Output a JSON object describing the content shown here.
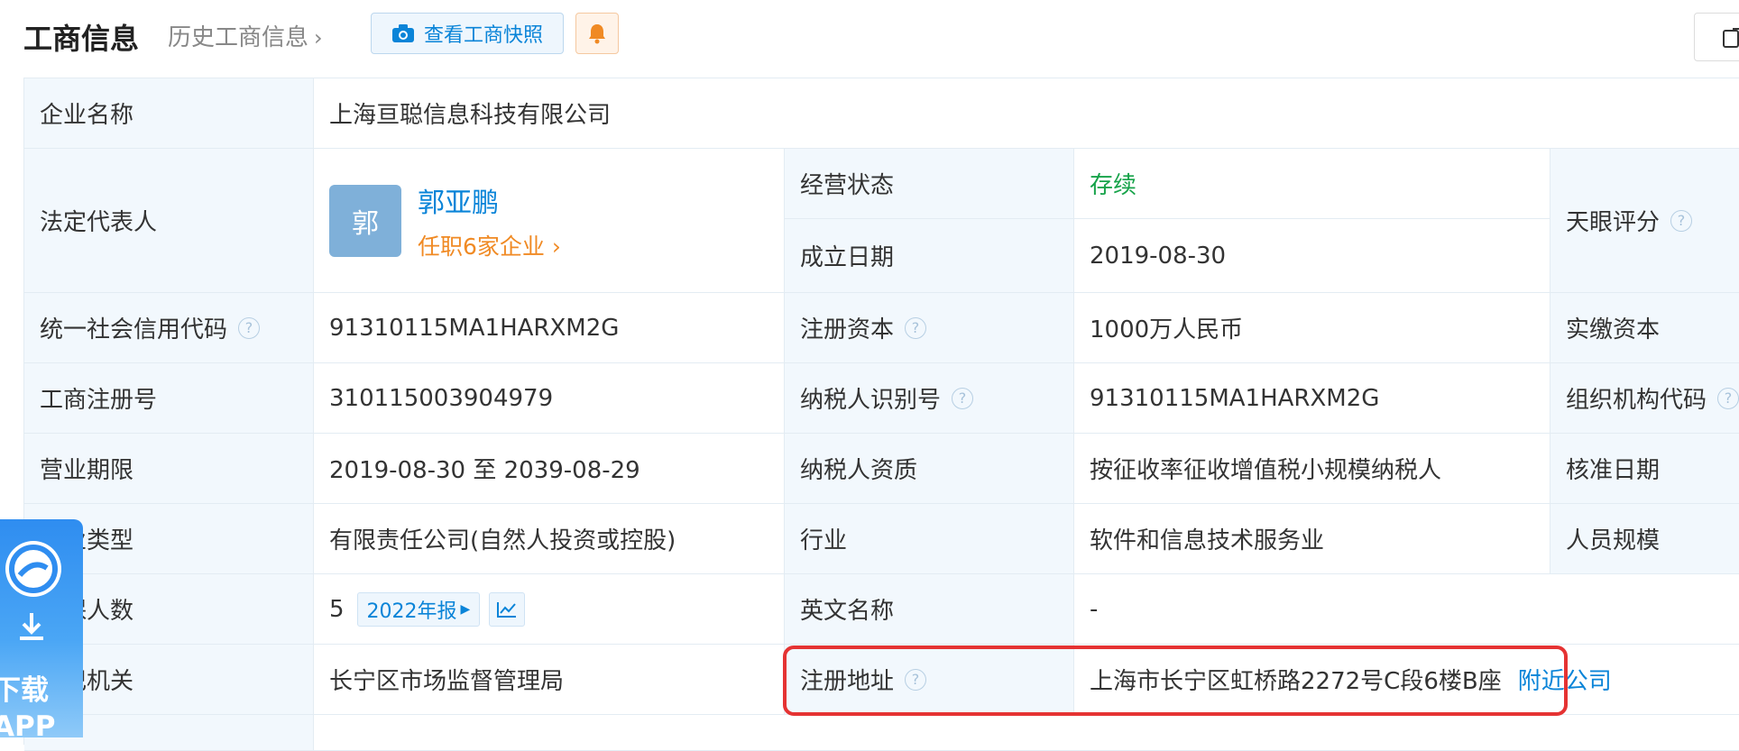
{
  "header": {
    "title": "工商信息",
    "history_link": "历史工商信息",
    "snapshot_button": "查看工商快照"
  },
  "rows": {
    "company_name": {
      "label": "企业名称",
      "value": "上海亘聪信息科技有限公司"
    },
    "legal_rep": {
      "label": "法定代表人",
      "avatar_char": "郭",
      "name": "郭亚鹏",
      "positions": "任职6家企业"
    },
    "status": {
      "label": "经营状态",
      "value": "存续"
    },
    "found_date": {
      "label": "成立日期",
      "value": "2019-08-30"
    },
    "tianyan_score": {
      "label": "天眼评分"
    },
    "credit_code": {
      "label": "统一社会信用代码",
      "value": "91310115MA1HARXM2G"
    },
    "reg_capital": {
      "label": "注册资本",
      "value": "1000万人民币"
    },
    "paid_capital": {
      "label": "实缴资本"
    },
    "reg_number": {
      "label": "工商注册号",
      "value": "310115003904979"
    },
    "taxpayer_id": {
      "label": "纳税人识别号",
      "value": "91310115MA1HARXM2G"
    },
    "org_code": {
      "label": "组织机构代码"
    },
    "business_term": {
      "label": "营业期限",
      "value": "2019-08-30 至 2039-08-29"
    },
    "taxpayer_qual": {
      "label": "纳税人资质",
      "value": "按征收率征收增值税小规模纳税人"
    },
    "approval_date": {
      "label": "核准日期"
    },
    "company_type": {
      "label": "企业类型",
      "value": "有限责任公司(自然人投资或控股)"
    },
    "industry": {
      "label": "行业",
      "value": "软件和信息技术服务业"
    },
    "staff_size": {
      "label": "人员规模"
    },
    "insured": {
      "label": "参保人数",
      "value": "5",
      "report_tag": "2022年报"
    },
    "english_name": {
      "label": "英文名称",
      "value": "-"
    },
    "reg_authority": {
      "label": "登记机关",
      "value": "长宁区市场监督管理局"
    },
    "reg_address": {
      "label": "注册地址",
      "value": "上海市长宁区虹桥路2272号C段6楼B座",
      "nearby_link": "附近公司"
    }
  },
  "app_widget": {
    "line1": "下载",
    "line2": "APP"
  },
  "colors": {
    "accent_blue": "#0a84d8",
    "status_green": "#17a34a",
    "orange": "#f08a24",
    "highlight_red": "#e53333"
  }
}
